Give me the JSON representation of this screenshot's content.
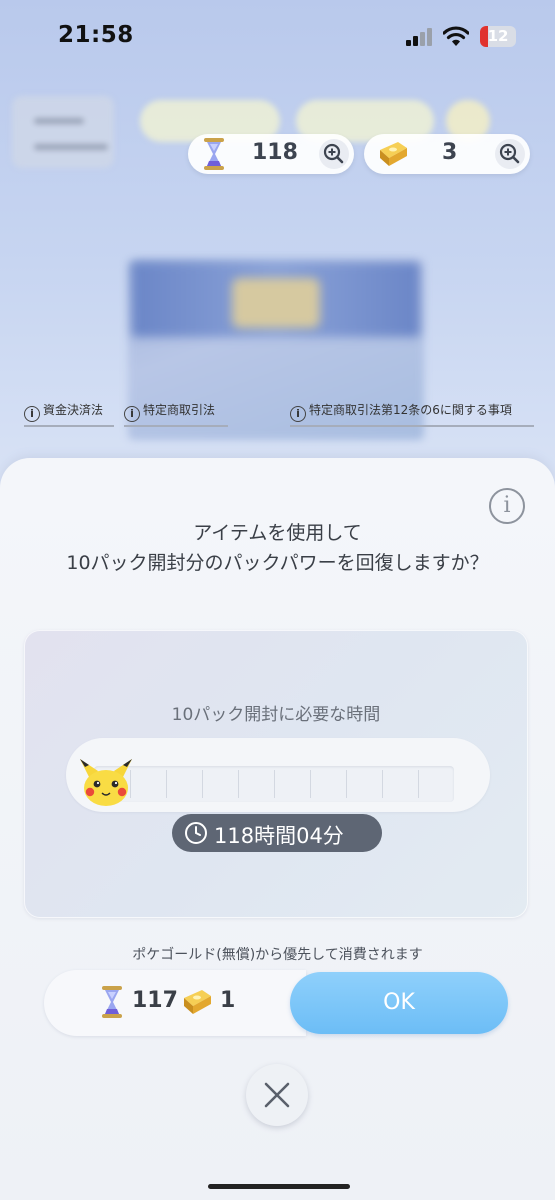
{
  "status_bar": {
    "time": "21:58",
    "battery": "12"
  },
  "currency": {
    "hourglass_count": "118",
    "gold_count": "3"
  },
  "legal_links": [
    {
      "label": "資金決済法"
    },
    {
      "label": "特定商取引法"
    },
    {
      "label": "特定商取引法第12条の6に関する事項"
    }
  ],
  "modal": {
    "title_line1": "アイテムを使用して",
    "title_line2": "10パック開封分のパックパワーを回復しますか？",
    "panel_label": "10パック開封に必要な時間",
    "progress_fraction": 0,
    "timer": "118時間04分",
    "notice": "ポケゴールド(無償)から優先して消費されます",
    "balance": {
      "hourglass_after": "117",
      "gold_after": "1"
    },
    "ok_label": "OK"
  },
  "colors": {
    "ok_button": "#7cc6f8",
    "timer_pill": "#5e6674",
    "battery_fill": "#e0322e"
  },
  "icons": [
    "hourglass-icon",
    "gold-bar-icon",
    "zoom-in-icon",
    "info-icon",
    "pikachu-icon",
    "clock-icon",
    "close-icon"
  ]
}
